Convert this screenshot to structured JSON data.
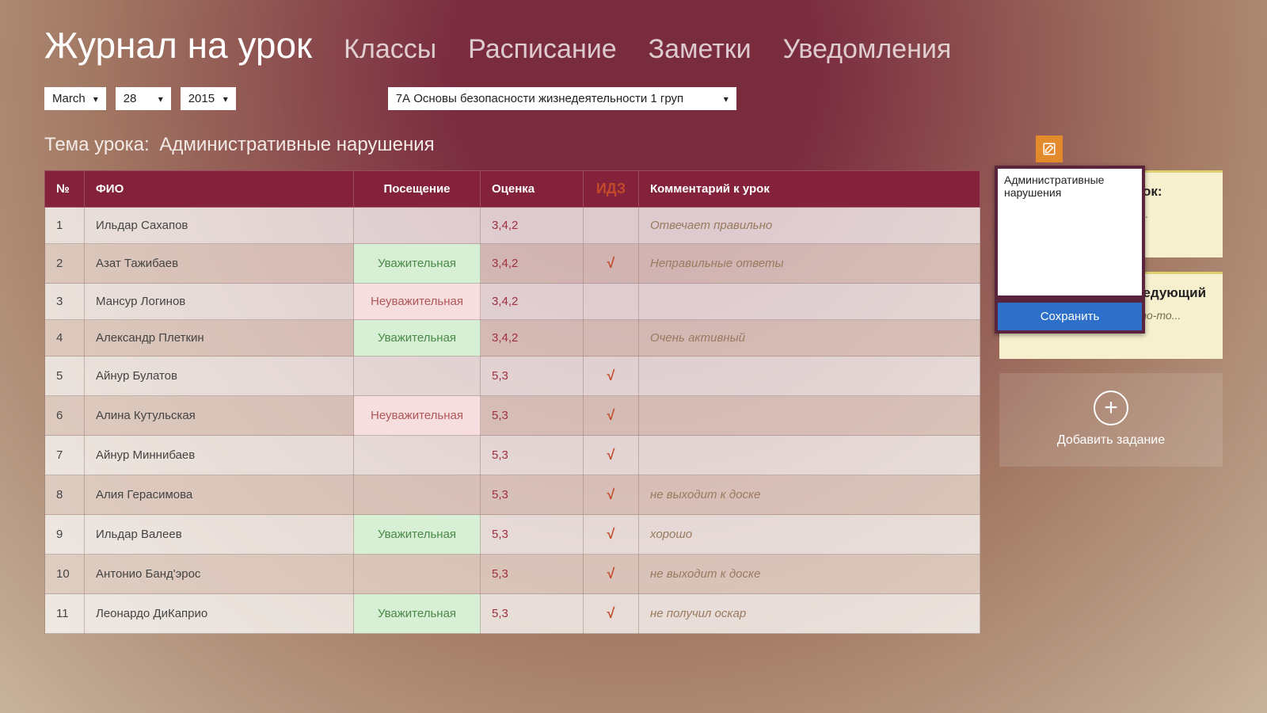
{
  "nav": {
    "title": "Журнал на урок",
    "items": [
      "Классы",
      "Расписание",
      "Заметки",
      "Уведомления"
    ]
  },
  "filters": {
    "month": "March",
    "day": "28",
    "year": "2015",
    "class": "7А Основы безопасности жизнедеятельности 1 груп"
  },
  "topic": {
    "label": "Тема урока:",
    "value": "Административные нарушения"
  },
  "table": {
    "headers": {
      "num": "№",
      "name": "ФИО",
      "attendance": "Посещение",
      "grade": "Оценка",
      "idz": "ИДЗ",
      "comment": "Комментарий к урок"
    },
    "rows": [
      {
        "num": "1",
        "name": "Ильдар Сахапов",
        "attendance": "",
        "att_type": "",
        "grade": "3,4,2",
        "idz": "",
        "comment": "Отвечает правильно"
      },
      {
        "num": "2",
        "name": "Азат Тажибаев",
        "attendance": "Уважительная",
        "att_type": "good",
        "grade": "3,4,2",
        "idz": "√",
        "comment": "Неправильные ответы"
      },
      {
        "num": "3",
        "name": "Мансур Логинов",
        "attendance": "Неуважительная",
        "att_type": "bad",
        "grade": "3,4,2",
        "idz": "",
        "comment": ""
      },
      {
        "num": "4",
        "name": "Александр Плеткин",
        "attendance": "Уважительная",
        "att_type": "good",
        "grade": "3,4,2",
        "idz": "",
        "comment": "Очень активный"
      },
      {
        "num": "5",
        "name": "Айнур Булатов",
        "attendance": "",
        "att_type": "",
        "grade": "5,3",
        "idz": "√",
        "comment": ""
      },
      {
        "num": "6",
        "name": "Алина Кутульская",
        "attendance": "Неуважительная",
        "att_type": "bad",
        "grade": "5,3",
        "idz": "√",
        "comment": ""
      },
      {
        "num": "7",
        "name": "Айнур Миннибаев",
        "attendance": "",
        "att_type": "",
        "grade": "5,3",
        "idz": "√",
        "comment": ""
      },
      {
        "num": "8",
        "name": "Алия Герасимова",
        "attendance": "",
        "att_type": "",
        "grade": "5,3",
        "idz": "√",
        "comment": "не выходит к доске"
      },
      {
        "num": "9",
        "name": "Ильдар Валеев",
        "attendance": "Уважительная",
        "att_type": "good",
        "grade": "5,3",
        "idz": "√",
        "comment": "хорошо"
      },
      {
        "num": "10",
        "name": "Антонио Банд'эрос",
        "attendance": "",
        "att_type": "",
        "grade": "5,3",
        "idz": "√",
        "comment": "не выходит к доске"
      },
      {
        "num": "11",
        "name": "Леонардо ДиКаприо",
        "attendance": "Уважительная",
        "att_type": "good",
        "grade": "5,3",
        "idz": "√",
        "comment": "не получил оскар"
      }
    ]
  },
  "popup": {
    "text": "Административные нарушения",
    "save": "Сохранить"
  },
  "homework": {
    "current": {
      "title": "шнее задание на урок:",
      "body": "ть это, сделать то-то..."
    },
    "next": {
      "title": "шнее задание на следующий",
      "body": "Сделать это, сделать то-то..."
    }
  },
  "addTask": "Добавить задание"
}
